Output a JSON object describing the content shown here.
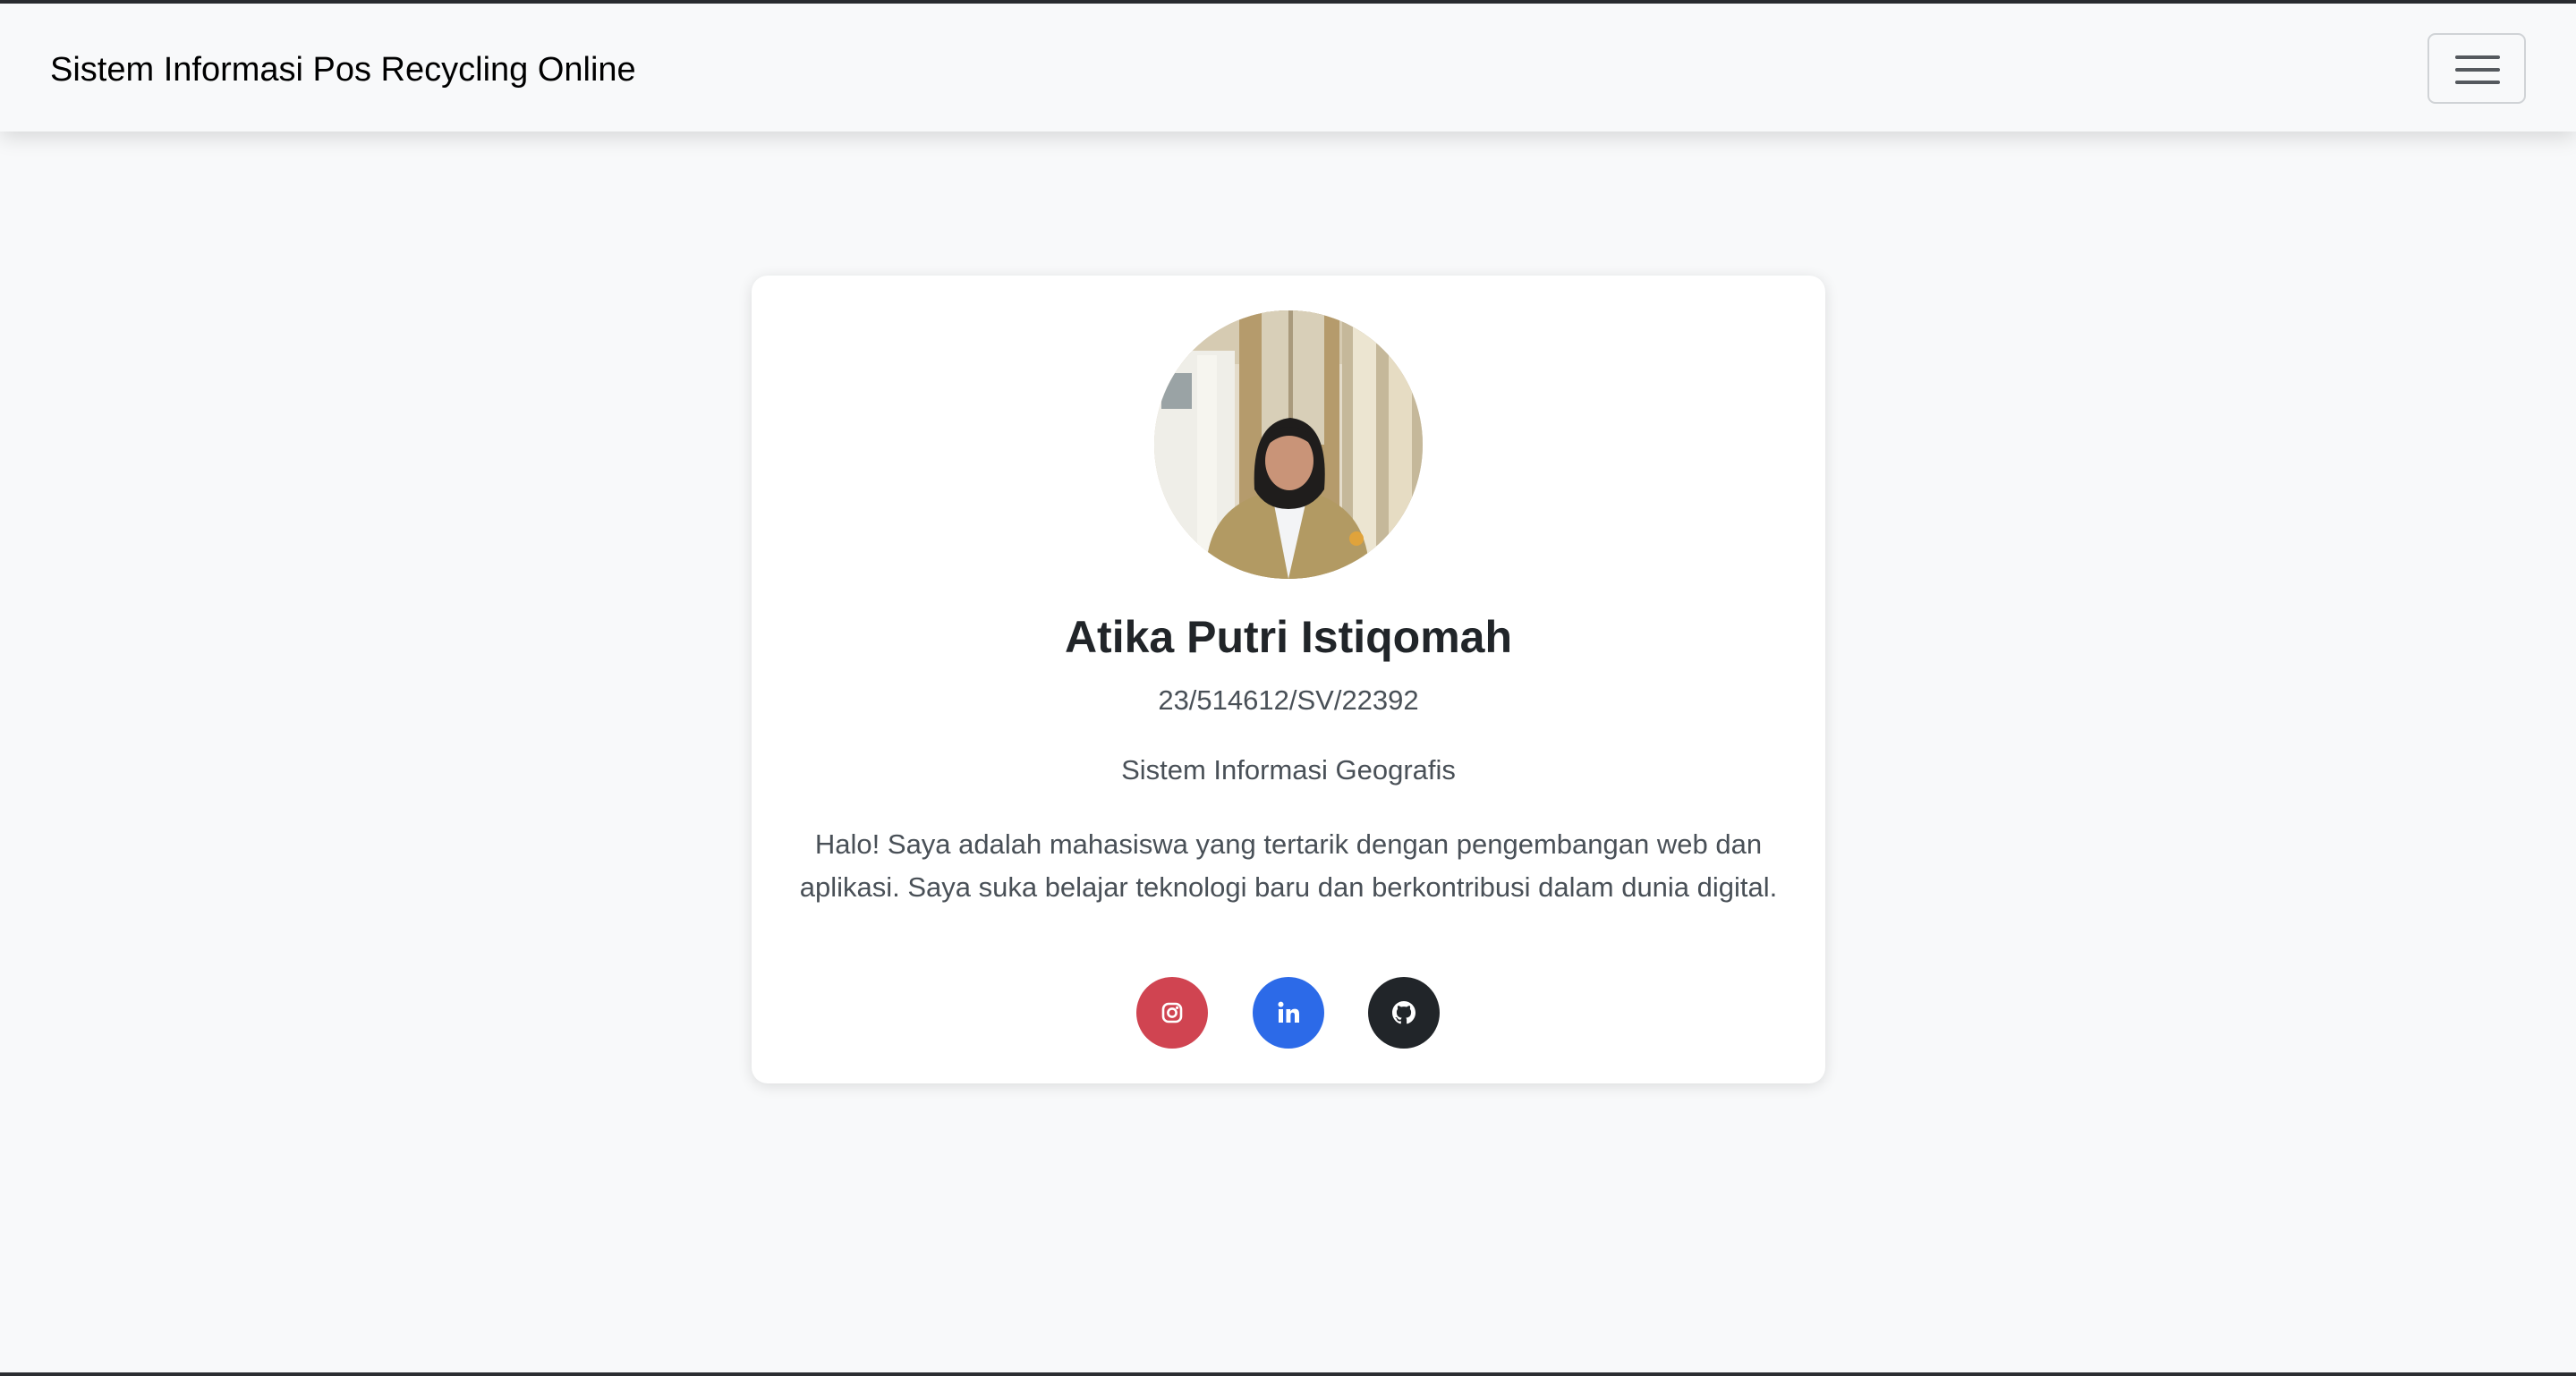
{
  "navbar": {
    "brand": "Sistem Informasi Pos Recycling Online",
    "menu_icon": "hamburger-menu-icon"
  },
  "profile": {
    "photo_alt": "Atika Putri Istiqomah",
    "name": "Atika Putri Istiqomah",
    "nim": "23/514612/SV/22392",
    "program": "Sistem Informasi Geografis",
    "bio": "Halo! Saya adalah mahasiswa yang tertarik dengan pengembangan web dan aplikasi. Saya suka belajar teknologi baru dan berkontribusi dalam dunia digital."
  },
  "social_links": [
    {
      "icon": "instagram-icon",
      "color": "#d04451"
    },
    {
      "icon": "linkedin-icon",
      "color": "#2c6ae8"
    },
    {
      "icon": "github-icon",
      "color": "#212529"
    }
  ],
  "colors": {
    "page_background": "#f8f9fa",
    "card_background": "#ffffff",
    "heading_text": "#212529",
    "body_text": "#495057"
  }
}
